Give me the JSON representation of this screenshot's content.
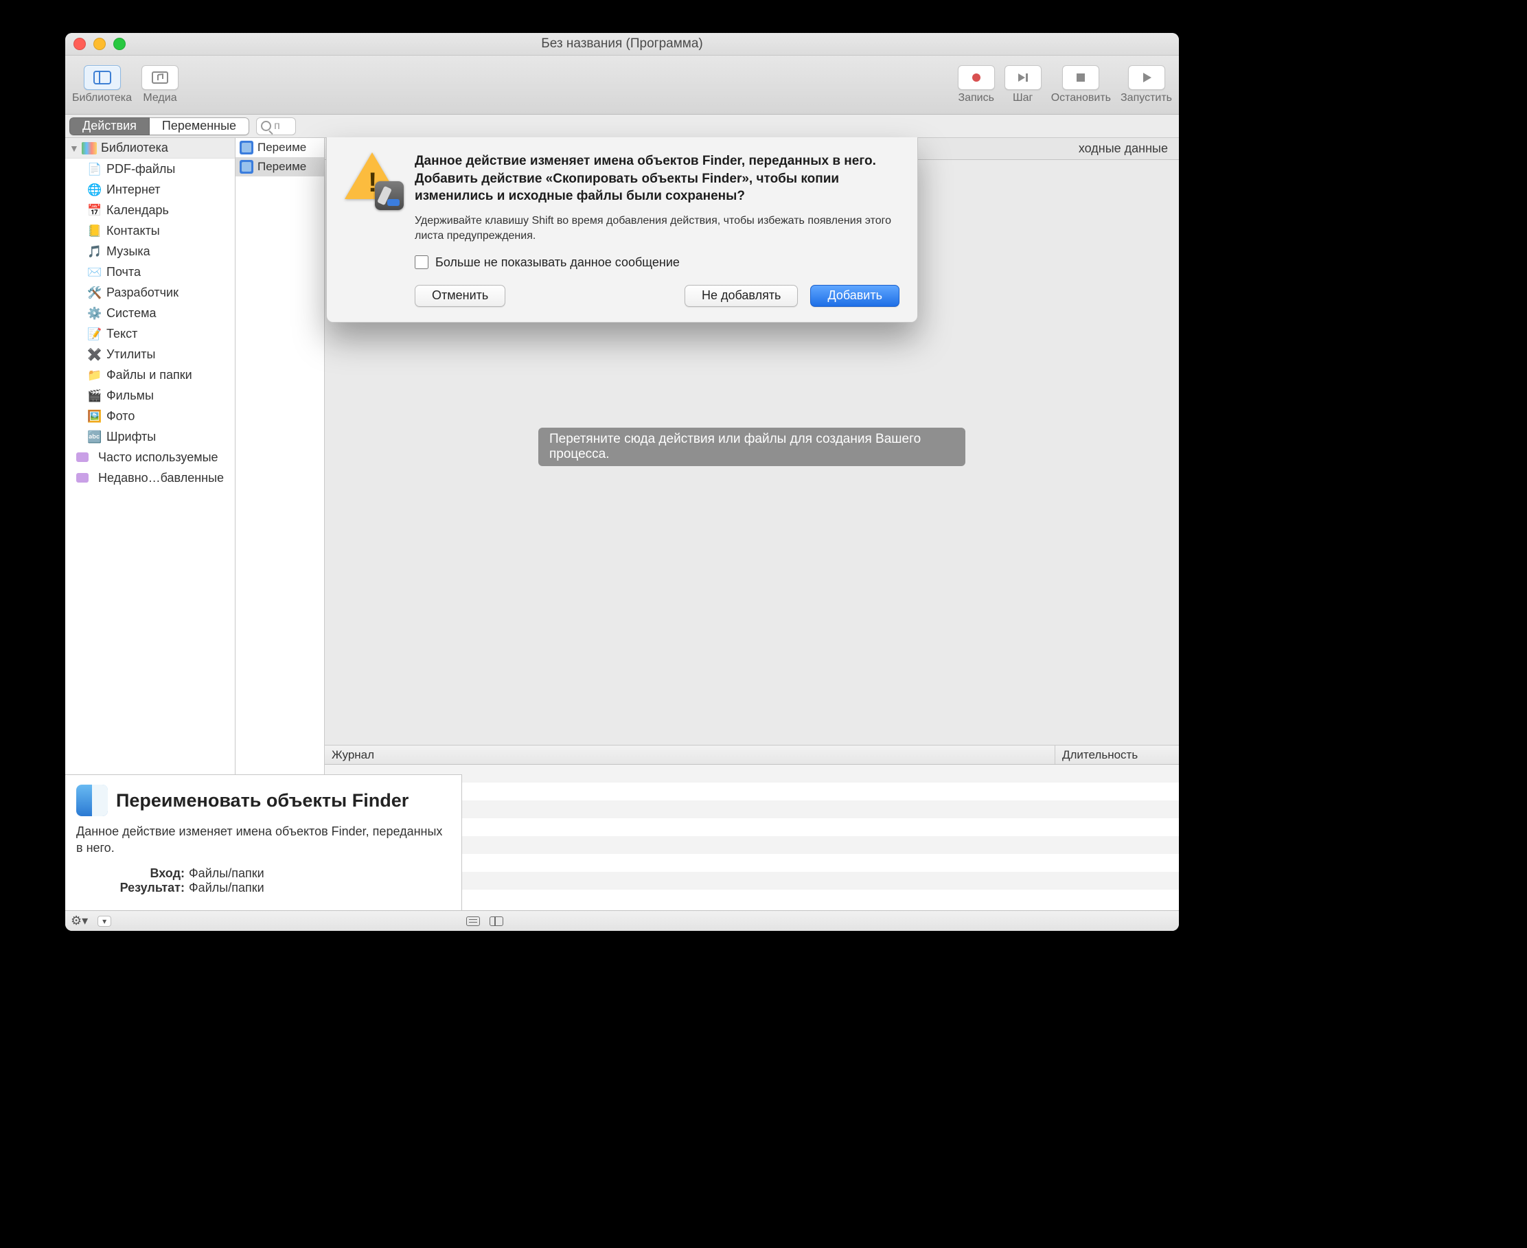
{
  "window": {
    "title": "Без названия (Программа)"
  },
  "toolbar": {
    "library": "Библиотека",
    "media": "Медиа",
    "record": "Запись",
    "step": "Шаг",
    "stop": "Остановить",
    "run": "Запустить"
  },
  "tabs": {
    "actions": "Действия",
    "variables": "Переменные",
    "search_prefix": "п"
  },
  "sidebar": {
    "root": "Библиотека",
    "items": [
      {
        "label": "PDF-файлы",
        "icon": "📄"
      },
      {
        "label": "Интернет",
        "icon": "🌐"
      },
      {
        "label": "Календарь",
        "icon": "📅"
      },
      {
        "label": "Контакты",
        "icon": "📒"
      },
      {
        "label": "Музыка",
        "icon": "🎵"
      },
      {
        "label": "Почта",
        "icon": "✉️"
      },
      {
        "label": "Разработчик",
        "icon": "🛠️"
      },
      {
        "label": "Система",
        "icon": "⚙️"
      },
      {
        "label": "Текст",
        "icon": "📝"
      },
      {
        "label": "Утилиты",
        "icon": "✖️"
      },
      {
        "label": "Файлы и папки",
        "icon": "📁"
      },
      {
        "label": "Фильмы",
        "icon": "🎬"
      },
      {
        "label": "Фото",
        "icon": "🖼️"
      },
      {
        "label": "Шрифты",
        "icon": "🔤"
      }
    ],
    "smart": [
      {
        "label": "Часто используемые"
      },
      {
        "label": "Недавно…бавленные"
      }
    ]
  },
  "actions_list": [
    {
      "label": "Переиме"
    },
    {
      "label": "Переиме"
    }
  ],
  "workflow": {
    "top_right": "ходные данные",
    "hint": "Перетяните сюда действия или файлы для создания Вашего процесса."
  },
  "log": {
    "col_main": "Журнал",
    "col_duration": "Длительность"
  },
  "description": {
    "title": "Переименовать объекты Finder",
    "body": "Данное действие изменяет имена объектов Finder, переданных в него.",
    "input_label": "Вход:",
    "input_value": "Файлы/папки",
    "result_label": "Результат:",
    "result_value": "Файлы/папки"
  },
  "statusbar": {
    "gear": "⚙︎"
  },
  "sheet": {
    "heading": "Данное действие изменяет имена объектов Finder, переданных в него. Добавить действие «Скопировать объекты Finder», чтобы копии изменились и исходные файлы были сохранены?",
    "note": "Удерживайте клавишу Shift во время добавления действия, чтобы избежать появления этого листа предупреждения.",
    "checkbox": "Больше не показывать данное сообщение",
    "cancel": "Отменить",
    "dont_add": "Не добавлять",
    "add": "Добавить"
  }
}
